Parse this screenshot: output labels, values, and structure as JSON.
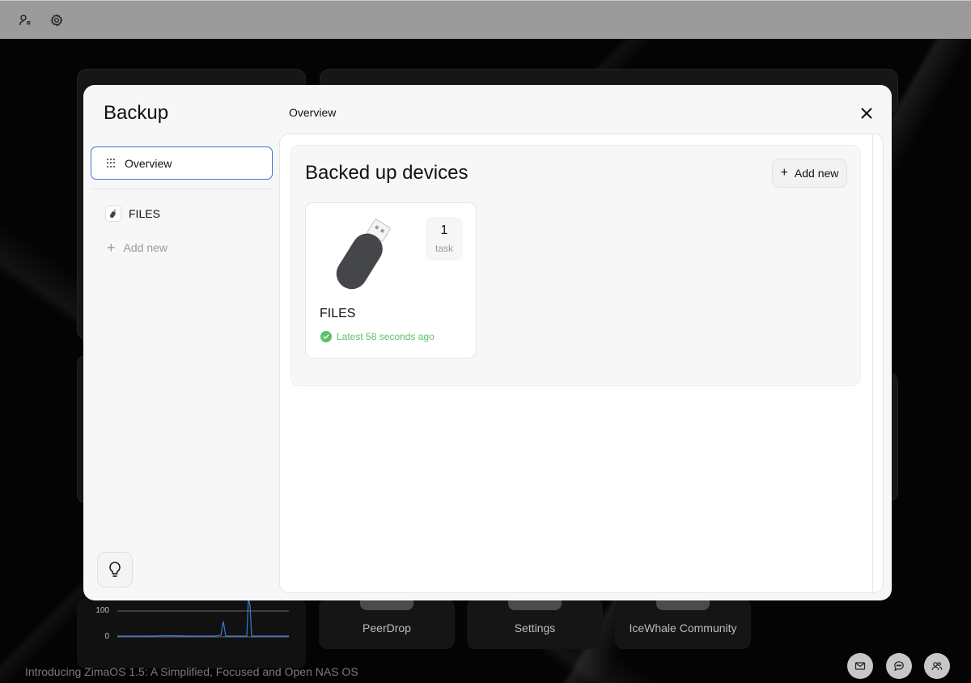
{
  "desktop": {
    "apps": [
      {
        "label": "PeerDrop"
      },
      {
        "label": "Settings"
      },
      {
        "label": "IceWhale Community"
      }
    ],
    "graph": {
      "tick_high": "100",
      "tick_low": "0"
    },
    "intro_text": "Introducing ZimaOS 1.5: A Simplified, Focused and Open NAS OS"
  },
  "modal": {
    "title": "Backup",
    "breadcrumb": "Overview",
    "sidebar": {
      "overview_label": "Overview",
      "devices": [
        {
          "label": "FILES"
        }
      ],
      "add_new_label": "Add new"
    },
    "main": {
      "section_title": "Backed up devices",
      "add_new_label": "Add new",
      "device_cards": [
        {
          "name": "FILES",
          "task_count": "1",
          "task_label": "task",
          "status": "Latest 58 seconds ago"
        }
      ]
    }
  },
  "colors": {
    "accent": "#3f74d8",
    "success": "#5cc26b"
  }
}
